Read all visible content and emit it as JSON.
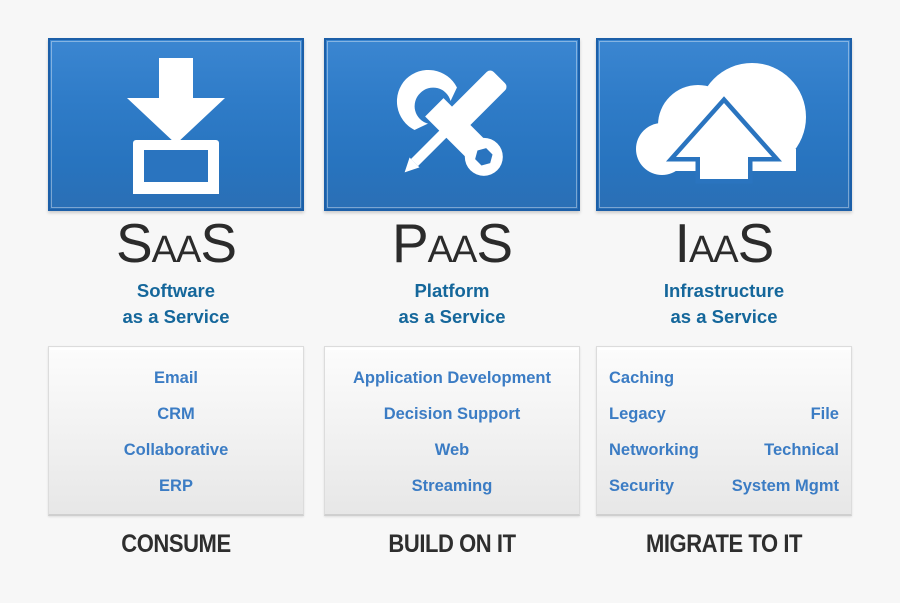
{
  "theme": {
    "background": "#f7f7f7",
    "panel_blue_top": "#3b86d1",
    "panel_blue_bottom": "#2a6fb5",
    "panel_border": "#1c5fa8",
    "subtitle_blue": "#15679b",
    "list_text_blue": "#3b7cc4",
    "action_text": "#2e2e2e",
    "glyph_white": "#ffffff"
  },
  "columns": [
    {
      "id": "saas",
      "icon_name": "download-to-monitor-icon",
      "acronym": {
        "first": "S",
        "middle": "AA",
        "last": "S",
        "full": "SaaS"
      },
      "subtitle": {
        "line1": "Software",
        "line2": "as a Service"
      },
      "list_layout": "single",
      "services": [
        "Email",
        "CRM",
        "Collaborative",
        "ERP"
      ],
      "action": "CONSUME"
    },
    {
      "id": "paas",
      "icon_name": "wrench-screwdriver-icon",
      "acronym": {
        "first": "P",
        "middle": "AA",
        "last": "S",
        "full": "PaaS"
      },
      "subtitle": {
        "line1": "Platform",
        "line2": "as a Service"
      },
      "list_layout": "single",
      "services": [
        "Application Development",
        "Decision Support",
        "Web",
        "Streaming"
      ],
      "action": "BUILD ON IT"
    },
    {
      "id": "iaas",
      "icon_name": "cloud-upload-icon",
      "acronym": {
        "first": "I",
        "middle": "AA",
        "last": "S",
        "full": "IaaS"
      },
      "subtitle": {
        "line1": "Infrastructure",
        "line2": "as a Service"
      },
      "list_layout": "two-column",
      "service_rows": [
        {
          "left": "Caching",
          "right": ""
        },
        {
          "left": "Legacy",
          "right": "File"
        },
        {
          "left": "Networking",
          "right": "Technical"
        },
        {
          "left": "Security",
          "right": "System Mgmt"
        }
      ],
      "action": "MIGRATE TO IT"
    }
  ]
}
